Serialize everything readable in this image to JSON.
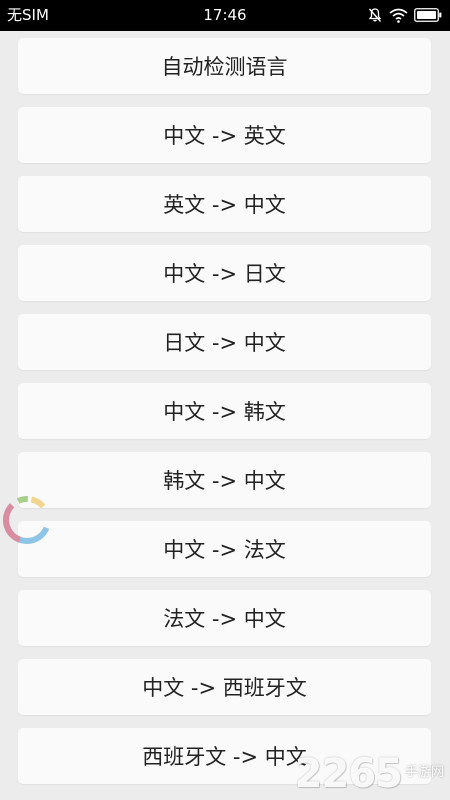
{
  "status_bar": {
    "carrier": "无SIM",
    "time": "17:46",
    "icons": [
      "mute-bell-icon",
      "wifi-icon",
      "battery-icon"
    ]
  },
  "languages": [
    "自动检测语言",
    "中文 -> 英文",
    "英文 -> 中文",
    "中文 -> 日文",
    "日文 -> 中文",
    "中文 -> 韩文",
    "韩文 -> 中文",
    "中文 -> 法文",
    "法文 -> 中文",
    "中文 -> 西班牙文",
    "西班牙文 -> 中文"
  ],
  "watermark": {
    "digits": "2265",
    "suffix": "手游网"
  },
  "colors": {
    "background": "#ececec",
    "button_bg": "#fafafa",
    "text": "#222222",
    "status_bar": "#000000",
    "spinner_blue": "#8ec5e6",
    "spinner_pink": "#d88da0",
    "spinner_green": "#a8d08a",
    "spinner_yellow": "#f0d690"
  }
}
